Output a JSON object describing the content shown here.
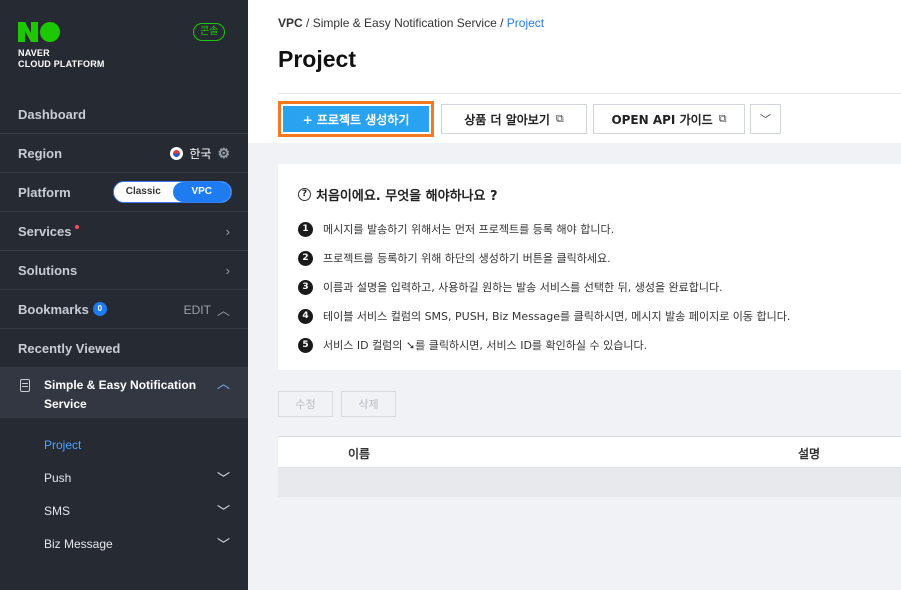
{
  "brand": {
    "logo_line1": "NAVER",
    "logo_line2": "CLOUD PLATFORM",
    "console_label": "콘솔",
    "colors": {
      "brand_green": "#1ec800",
      "accent_blue": "#1e7cf0",
      "sidebar_bg": "#262a33"
    }
  },
  "sidebar": {
    "dashboard": "Dashboard",
    "region_label": "Region",
    "region_value": "한국",
    "platform_label": "Platform",
    "platform_options": [
      "Classic",
      "VPC"
    ],
    "platform_selected": "VPC",
    "services": "Services",
    "solutions": "Solutions",
    "bookmarks": "Bookmarks",
    "bookmarks_count": "0",
    "bookmarks_edit": "EDIT",
    "recently_viewed": "Recently Viewed",
    "service_name_line1": "Simple & Easy Notification",
    "service_name_line2": "Service",
    "sub_items": [
      "Project",
      "Push",
      "SMS",
      "Biz Message"
    ],
    "active_sub_item": "Project"
  },
  "header": {
    "breadcrumb": [
      "VPC",
      "Simple & Easy Notification Service",
      "Project"
    ],
    "title": "Project"
  },
  "toolbar": {
    "create_label": "+ 프로젝트 생성하기",
    "learn_more_label": "상품 더 알아보기",
    "api_guide_label": "OPEN API 가이드"
  },
  "guide": {
    "title": "처음이에요. 무엇을 해야하나요 ?",
    "steps": [
      "메시지를 발송하기 위해서는 먼저 프로젝트를 등록 해야 합니다.",
      "프로젝트를 등록하기 위해 하단의 생성하기 버튼을 클릭하세요.",
      "이름과 설명을 입력하고, 사용하길 원하는 발송 서비스를 선택한 뒤, 생성을 완료합니다.",
      "테이블 서비스 컬럼의 SMS, PUSH, Biz Message를 클릭하시면, 메시지 발송 페이지로 이동 합니다.",
      "서비스 ID 컬럼의 ",
      "를 클릭하시면, 서비스 ID를 확인하실 수 있습니다."
    ]
  },
  "actions": {
    "edit_label": "수정",
    "delete_label": "삭제"
  },
  "table": {
    "columns": [
      "이름",
      "설명"
    ]
  }
}
